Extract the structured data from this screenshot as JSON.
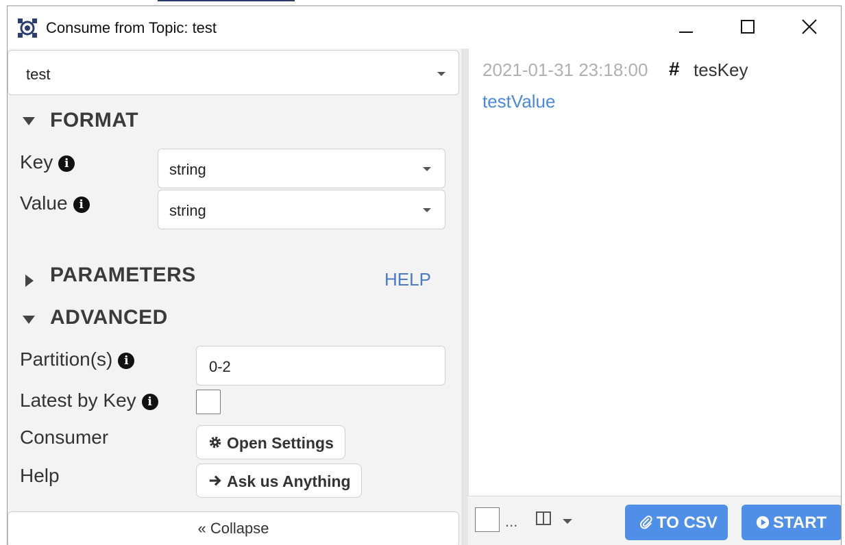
{
  "window": {
    "title": "Consume from Topic: test"
  },
  "topic": {
    "selected": "test"
  },
  "format": {
    "heading": "FORMAT",
    "key_label": "Key",
    "key_value": "string",
    "value_label": "Value",
    "value_value": "string"
  },
  "parameters": {
    "heading": "PARAMETERS",
    "help_link": "HELP"
  },
  "advanced": {
    "heading": "ADVANCED",
    "partitions_label": "Partition(s)",
    "partitions_value": "0-2",
    "latest_by_key_label": "Latest by Key",
    "consumer_label": "Consumer",
    "open_settings_label": "Open Settings",
    "help_label": "Help",
    "ask_label": "Ask us Anything"
  },
  "collapse": {
    "label": "« Collapse"
  },
  "messages": [
    {
      "timestamp": "2021-01-31 23:18:00",
      "hash": "#",
      "key": "tesKey",
      "value": "testValue"
    }
  ],
  "bottom_bar": {
    "ellipsis": "...",
    "to_csv_label": "TO CSV",
    "start_label": "START"
  },
  "colors": {
    "accent": "#4f8fe8",
    "link": "#4a7ac9",
    "message_value": "#4a88e0",
    "timestamp": "#b0b0b0"
  },
  "icons": {
    "app": "kafka-app-icon",
    "minimize": "minimize-icon",
    "maximize": "maximize-icon",
    "close": "close-icon",
    "info": "info-icon",
    "gear": "gear-icon",
    "arrow": "arrow-right-icon",
    "paperclip": "paperclip-icon",
    "play": "play-icon",
    "columns": "columns-icon"
  }
}
